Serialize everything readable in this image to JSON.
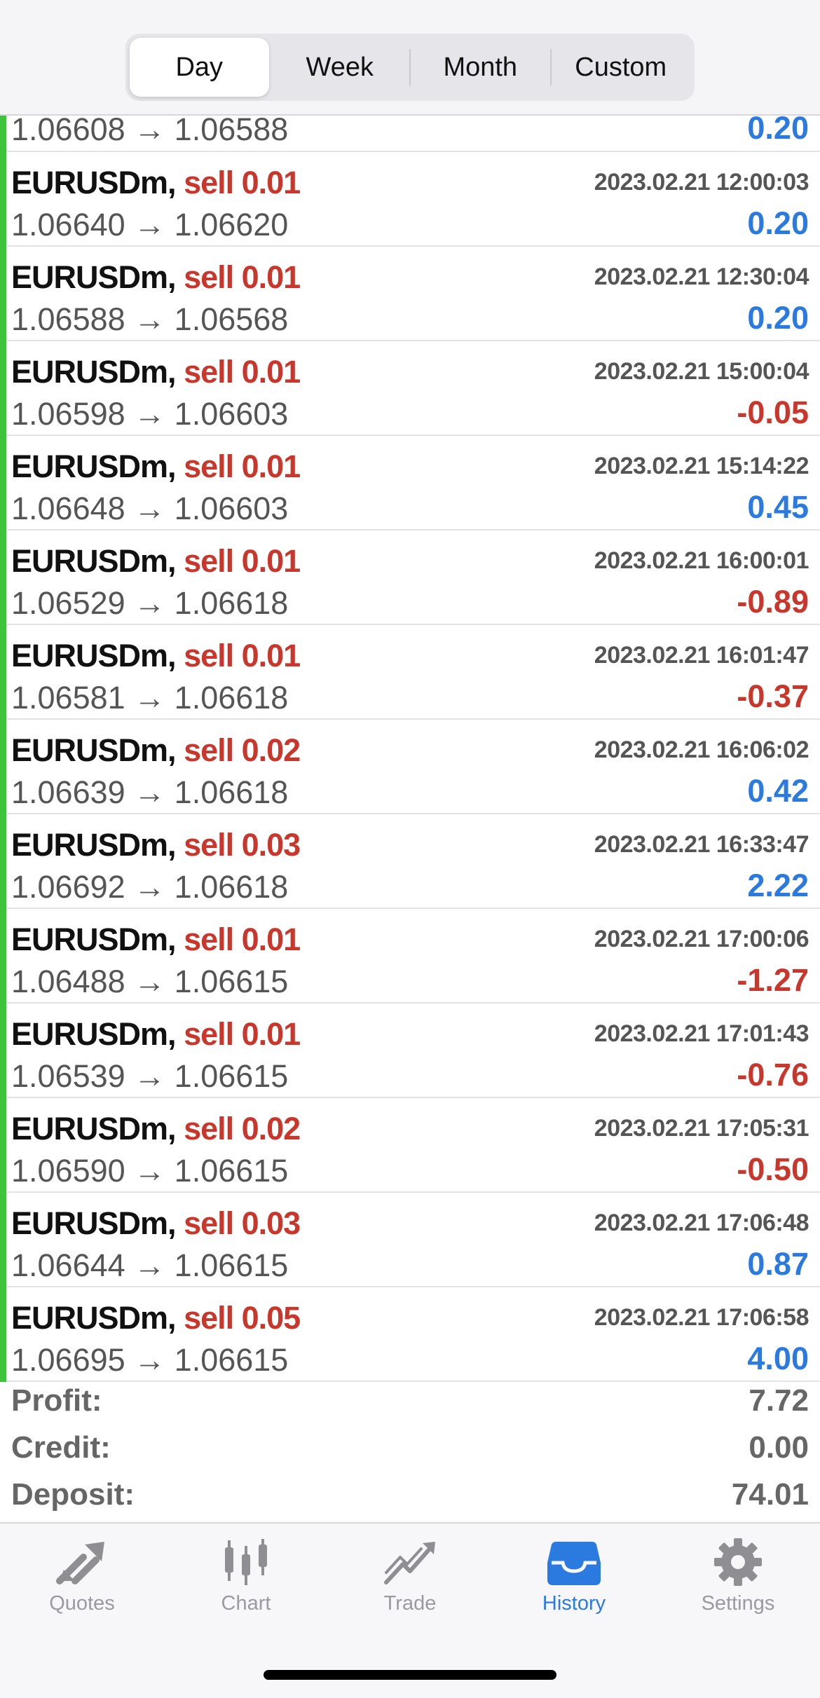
{
  "tabs_period": [
    "Day",
    "Week",
    "Month",
    "Custom"
  ],
  "active_period": "Day",
  "partial_row": {
    "prices": "1.06608 → 1.06588",
    "profit": "0.20",
    "positive": true
  },
  "deals": [
    {
      "symbol": "EURUSDm,",
      "action": "sell 0.01",
      "time": "2023.02.21 12:00:03",
      "prices": "1.06640 → 1.06620",
      "profit": "0.20",
      "positive": true
    },
    {
      "symbol": "EURUSDm,",
      "action": "sell 0.01",
      "time": "2023.02.21 12:30:04",
      "prices": "1.06588 → 1.06568",
      "profit": "0.20",
      "positive": true
    },
    {
      "symbol": "EURUSDm,",
      "action": "sell 0.01",
      "time": "2023.02.21 15:00:04",
      "prices": "1.06598 → 1.06603",
      "profit": "-0.05",
      "positive": false
    },
    {
      "symbol": "EURUSDm,",
      "action": "sell 0.01",
      "time": "2023.02.21 15:14:22",
      "prices": "1.06648 → 1.06603",
      "profit": "0.45",
      "positive": true
    },
    {
      "symbol": "EURUSDm,",
      "action": "sell 0.01",
      "time": "2023.02.21 16:00:01",
      "prices": "1.06529 → 1.06618",
      "profit": "-0.89",
      "positive": false
    },
    {
      "symbol": "EURUSDm,",
      "action": "sell 0.01",
      "time": "2023.02.21 16:01:47",
      "prices": "1.06581 → 1.06618",
      "profit": "-0.37",
      "positive": false
    },
    {
      "symbol": "EURUSDm,",
      "action": "sell 0.02",
      "time": "2023.02.21 16:06:02",
      "prices": "1.06639 → 1.06618",
      "profit": "0.42",
      "positive": true
    },
    {
      "symbol": "EURUSDm,",
      "action": "sell 0.03",
      "time": "2023.02.21 16:33:47",
      "prices": "1.06692 → 1.06618",
      "profit": "2.22",
      "positive": true
    },
    {
      "symbol": "EURUSDm,",
      "action": "sell 0.01",
      "time": "2023.02.21 17:00:06",
      "prices": "1.06488 → 1.06615",
      "profit": "-1.27",
      "positive": false
    },
    {
      "symbol": "EURUSDm,",
      "action": "sell 0.01",
      "time": "2023.02.21 17:01:43",
      "prices": "1.06539 → 1.06615",
      "profit": "-0.76",
      "positive": false
    },
    {
      "symbol": "EURUSDm,",
      "action": "sell 0.02",
      "time": "2023.02.21 17:05:31",
      "prices": "1.06590 → 1.06615",
      "profit": "-0.50",
      "positive": false
    },
    {
      "symbol": "EURUSDm,",
      "action": "sell 0.03",
      "time": "2023.02.21 17:06:48",
      "prices": "1.06644 → 1.06615",
      "profit": "0.87",
      "positive": true
    },
    {
      "symbol": "EURUSDm,",
      "action": "sell 0.05",
      "time": "2023.02.21 17:06:58",
      "prices": "1.06695 → 1.06615",
      "profit": "4.00",
      "positive": true
    }
  ],
  "summary": [
    {
      "label": "Profit:",
      "value": "7.72"
    },
    {
      "label": "Credit:",
      "value": "0.00"
    },
    {
      "label": "Deposit:",
      "value": "74.01"
    }
  ],
  "tabbar": [
    {
      "label": "Quotes",
      "icon": "quotes-icon"
    },
    {
      "label": "Chart",
      "icon": "chart-icon"
    },
    {
      "label": "Trade",
      "icon": "trade-icon"
    },
    {
      "label": "History",
      "icon": "history-icon",
      "active": true
    },
    {
      "label": "Settings",
      "icon": "settings-icon"
    }
  ],
  "colors": {
    "positive": "#2b7ae0",
    "negative": "#c9372c",
    "accent": "#2b7ae0",
    "row_marker": "#3ec43a"
  }
}
